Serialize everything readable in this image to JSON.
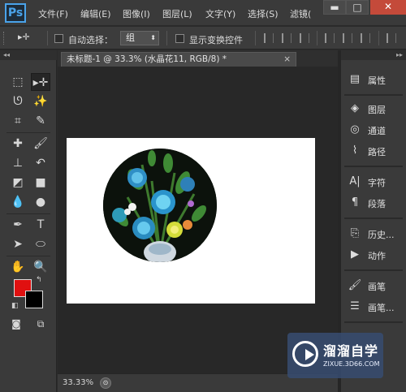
{
  "app": {
    "logo_text": "Ps",
    "menu": [
      "文件(F)",
      "编辑(E)",
      "图像(I)",
      "图层(L)",
      "文字(Y)",
      "选择(S)",
      "滤镜("
    ],
    "window_buttons": {
      "minimize": "▬",
      "maximize": "□",
      "close": "✕"
    }
  },
  "options_bar": {
    "tool_glyph": "▸✛",
    "auto_select_label": "自动选择：",
    "auto_select_checked": false,
    "auto_select_value": "组",
    "show_transform_label": "显示变换控件",
    "show_transform_checked": false
  },
  "toolbox": {
    "collapse_glyph": "◂◂",
    "tools": [
      {
        "name": "rectangular-marquee",
        "glyph": "⬚"
      },
      {
        "name": "move",
        "glyph": "▸✛",
        "active": true
      },
      {
        "name": "lasso",
        "glyph": "ᘎ"
      },
      {
        "name": "magic-wand",
        "glyph": "✨"
      },
      {
        "name": "crop",
        "glyph": "⌗"
      },
      {
        "name": "eyedropper",
        "glyph": "✎"
      },
      {
        "name": "spot-healing",
        "glyph": "✚"
      },
      {
        "name": "brush",
        "glyph": "🖌"
      },
      {
        "name": "clone-stamp",
        "glyph": "⊥"
      },
      {
        "name": "history-brush",
        "glyph": "↶"
      },
      {
        "name": "eraser",
        "glyph": "◩"
      },
      {
        "name": "gradient",
        "glyph": "■"
      },
      {
        "name": "blur",
        "glyph": "💧"
      },
      {
        "name": "dodge",
        "glyph": "●"
      },
      {
        "name": "pen",
        "glyph": "✒"
      },
      {
        "name": "type",
        "glyph": "T"
      },
      {
        "name": "path-selection",
        "glyph": "➤"
      },
      {
        "name": "ellipse",
        "glyph": "⬭"
      },
      {
        "name": "hand",
        "glyph": "✋"
      },
      {
        "name": "zoom",
        "glyph": "🔍"
      }
    ],
    "foreground_color": "#e01010",
    "background_color": "#000000"
  },
  "document": {
    "tab_title": "未标题-1 @ 33.3% (水晶花11, RGB/8) *",
    "close_glyph": "×"
  },
  "status_bar": {
    "zoom": "33.33%",
    "icon_glyph": "⊙"
  },
  "panels": {
    "collapse_glyph": "▸▸",
    "groups": [
      [
        {
          "icon": "properties-icon",
          "glyph": "▤",
          "label": "属性"
        }
      ],
      [
        {
          "icon": "layers-icon",
          "glyph": "◈",
          "label": "图层"
        },
        {
          "icon": "channels-icon",
          "glyph": "◎",
          "label": "通道"
        },
        {
          "icon": "paths-icon",
          "glyph": "⌇",
          "label": "路径"
        }
      ],
      [
        {
          "icon": "character-icon",
          "glyph": "A|",
          "label": "字符"
        },
        {
          "icon": "paragraph-icon",
          "glyph": "¶",
          "label": "段落"
        }
      ],
      [
        {
          "icon": "history-icon",
          "glyph": "⎘",
          "label": "历史..."
        },
        {
          "icon": "actions-icon",
          "glyph": "▶",
          "label": "动作"
        }
      ],
      [
        {
          "icon": "brush-panel-icon",
          "glyph": "🖌",
          "label": "画笔"
        },
        {
          "icon": "brush-presets-icon",
          "glyph": "☰",
          "label": "画笔..."
        }
      ]
    ]
  },
  "watermark": {
    "title": "溜溜自学",
    "url": "ZIXUE.3D66.COM"
  }
}
